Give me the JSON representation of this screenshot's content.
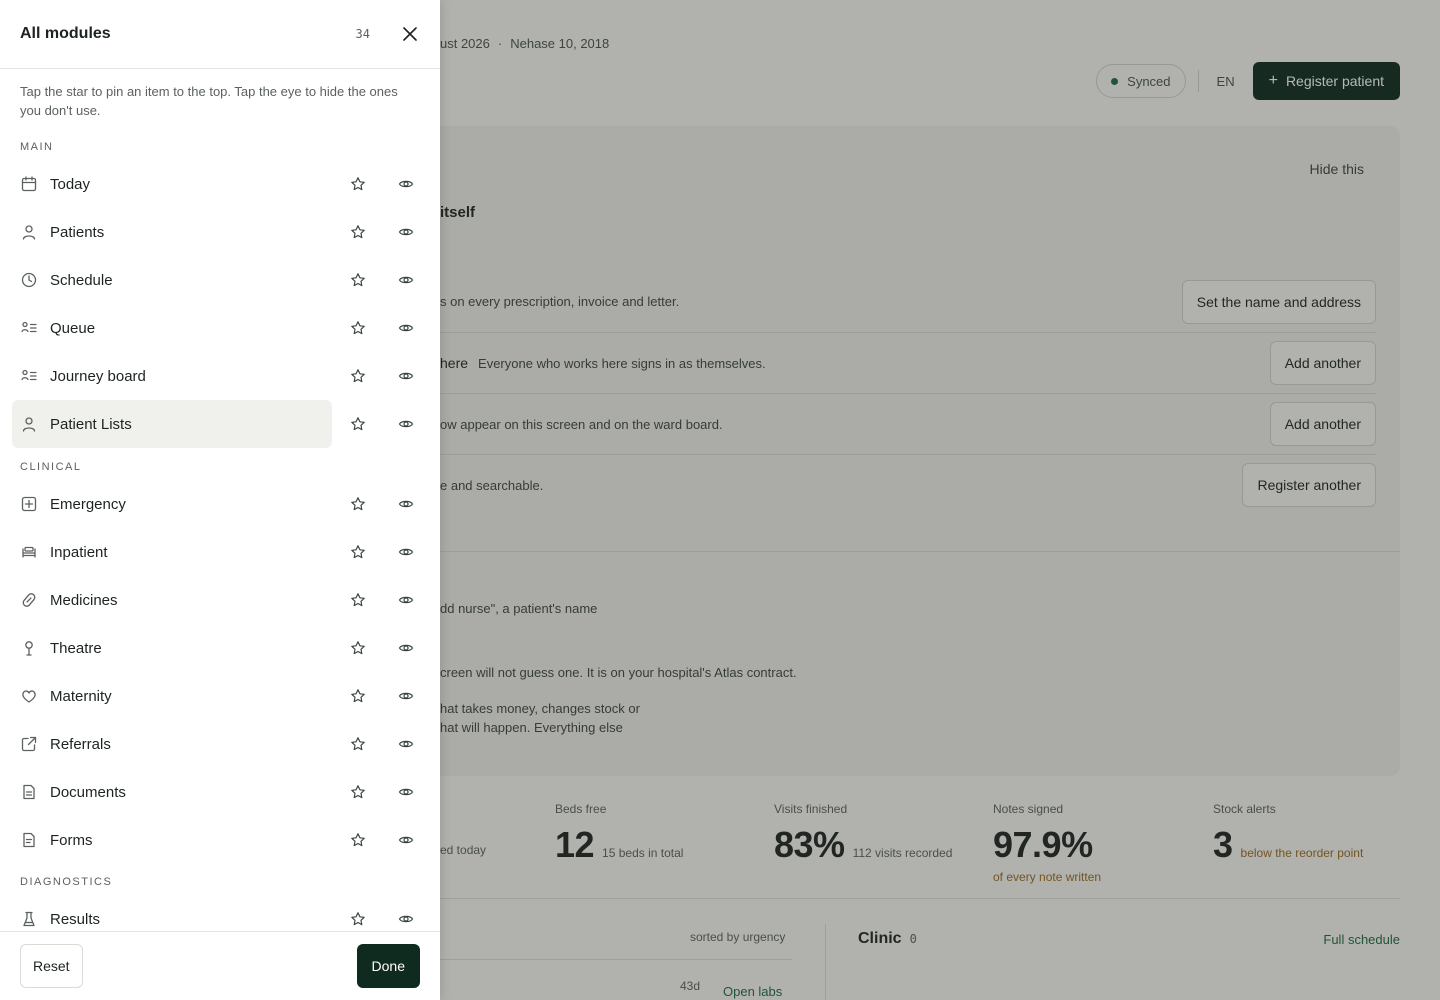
{
  "background": {
    "date_month": "ust 2026",
    "date_alt": "Nehase 10, 2018",
    "sync_status": "Synced",
    "language": "EN",
    "register_button": "Register patient",
    "hide_label": "Hide this",
    "card_title_fragment": "itself",
    "setup_rows": [
      {
        "link": "",
        "text": "s on every prescription, invoice and letter.",
        "button": "Set the name and address"
      },
      {
        "link": "here",
        "text": "Everyone who works here signs in as themselves.",
        "button": "Add another"
      },
      {
        "link": "",
        "text": "ow appear on this screen and on the ward board.",
        "button": "Add another"
      },
      {
        "link": "",
        "text": "e and searchable.",
        "button": "Register another"
      }
    ],
    "notes": [
      "dd nurse\", a patient's name",
      "creen will not guess one. It is on your hospital's Atlas contract.",
      "hat takes money, changes stock or",
      "hat will happen. Everything else"
    ],
    "stats_partial": "ed today",
    "stats": [
      {
        "label": "Beds free",
        "value": "12",
        "sub": "15 beds in total",
        "sub2": ""
      },
      {
        "label": "Visits finished",
        "value": "83%",
        "sub": "112 visits recorded",
        "sub2": ""
      },
      {
        "label": "Notes signed",
        "value": "97.9%",
        "sub": "",
        "sub2": "of every note written"
      },
      {
        "label": "Stock alerts",
        "value": "3",
        "sub": "below the reorder point",
        "sub2": ""
      }
    ],
    "sorted_label": "sorted by urgency",
    "row_age": "43d",
    "open_labs": "Open labs",
    "clinic_title": "Clinic",
    "clinic_count": "0",
    "full_schedule": "Full schedule"
  },
  "drawer": {
    "title": "All modules",
    "count": "34",
    "hint": "Tap the star to pin an item to the top. Tap the eye to hide the ones you don't use.",
    "sections": [
      {
        "label": "MAIN"
      },
      {
        "label": "CLINICAL"
      },
      {
        "label": "DIAGNOSTICS"
      }
    ],
    "items": [
      {
        "label": "Today",
        "icon": "calendar-icon"
      },
      {
        "label": "Patients",
        "icon": "person-icon"
      },
      {
        "label": "Schedule",
        "icon": "clock-icon"
      },
      {
        "label": "Queue",
        "icon": "queue-list-icon"
      },
      {
        "label": "Journey board",
        "icon": "queue-list-icon"
      },
      {
        "label": "Patient Lists",
        "icon": "person-icon"
      },
      {
        "label": "Emergency",
        "icon": "plus-square-icon"
      },
      {
        "label": "Inpatient",
        "icon": "bed-icon"
      },
      {
        "label": "Medicines",
        "icon": "pill-icon"
      },
      {
        "label": "Theatre",
        "icon": "scalpel-icon"
      },
      {
        "label": "Maternity",
        "icon": "heart-icon"
      },
      {
        "label": "Referrals",
        "icon": "external-link-icon"
      },
      {
        "label": "Documents",
        "icon": "document-icon"
      },
      {
        "label": "Forms",
        "icon": "form-icon"
      },
      {
        "label": "Results",
        "icon": "flask-icon"
      }
    ],
    "footer": {
      "reset": "Reset",
      "done": "Done"
    }
  }
}
